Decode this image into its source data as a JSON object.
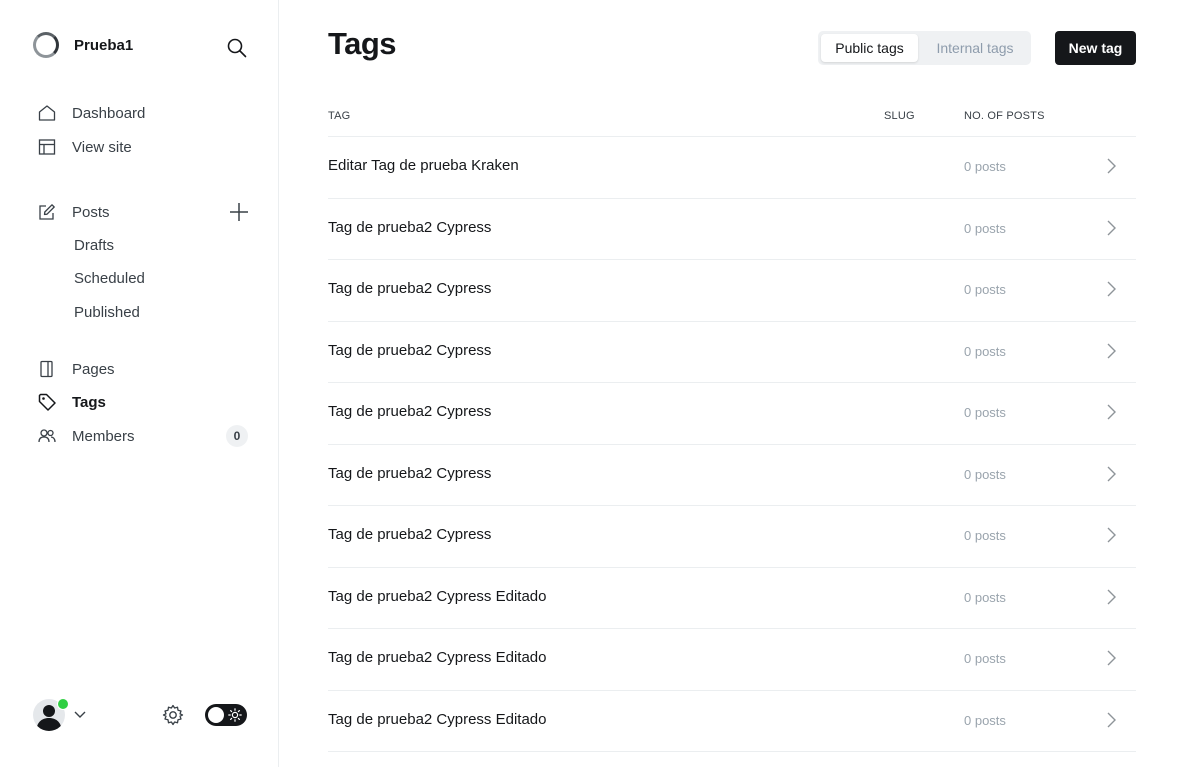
{
  "sidebar": {
    "site_name": "Prueba1",
    "nav": {
      "dashboard": "Dashboard",
      "view_site": "View site",
      "posts": "Posts",
      "drafts": "Drafts",
      "scheduled": "Scheduled",
      "published": "Published",
      "pages": "Pages",
      "tags": "Tags",
      "members": "Members",
      "members_count": "0"
    }
  },
  "header": {
    "title": "Tags",
    "public_tab": "Public tags",
    "internal_tab": "Internal tags",
    "new_tag_label": "New tag"
  },
  "table": {
    "columns": [
      "TAG",
      "SLUG",
      "NO. OF POSTS"
    ],
    "rows": [
      {
        "name": "Editar Tag de prueba Kraken",
        "slug": "",
        "posts": "0 posts"
      },
      {
        "name": "Tag de prueba2 Cypress",
        "slug": "",
        "posts": "0 posts"
      },
      {
        "name": "Tag de prueba2 Cypress",
        "slug": "",
        "posts": "0 posts"
      },
      {
        "name": "Tag de prueba2 Cypress",
        "slug": "",
        "posts": "0 posts"
      },
      {
        "name": "Tag de prueba2 Cypress",
        "slug": "",
        "posts": "0 posts"
      },
      {
        "name": "Tag de prueba2 Cypress",
        "slug": "",
        "posts": "0 posts"
      },
      {
        "name": "Tag de prueba2 Cypress",
        "slug": "",
        "posts": "0 posts"
      },
      {
        "name": "Tag de prueba2 Cypress Editado",
        "slug": "",
        "posts": "0 posts"
      },
      {
        "name": "Tag de prueba2 Cypress Editado",
        "slug": "",
        "posts": "0 posts"
      },
      {
        "name": "Tag de prueba2 Cypress Editado",
        "slug": "",
        "posts": "0 posts"
      }
    ]
  },
  "icons": {
    "search": "search-icon",
    "home": "home-icon",
    "view_site": "layout-icon",
    "posts": "edit-icon",
    "add": "plus-icon",
    "pages": "page-icon",
    "tags": "tag-icon",
    "members": "members-icon",
    "settings": "gear-icon",
    "chevron": "chevron-right-icon"
  },
  "colors": {
    "accent": "#15171a",
    "online": "#30cf43",
    "border": "#ebeef0"
  }
}
